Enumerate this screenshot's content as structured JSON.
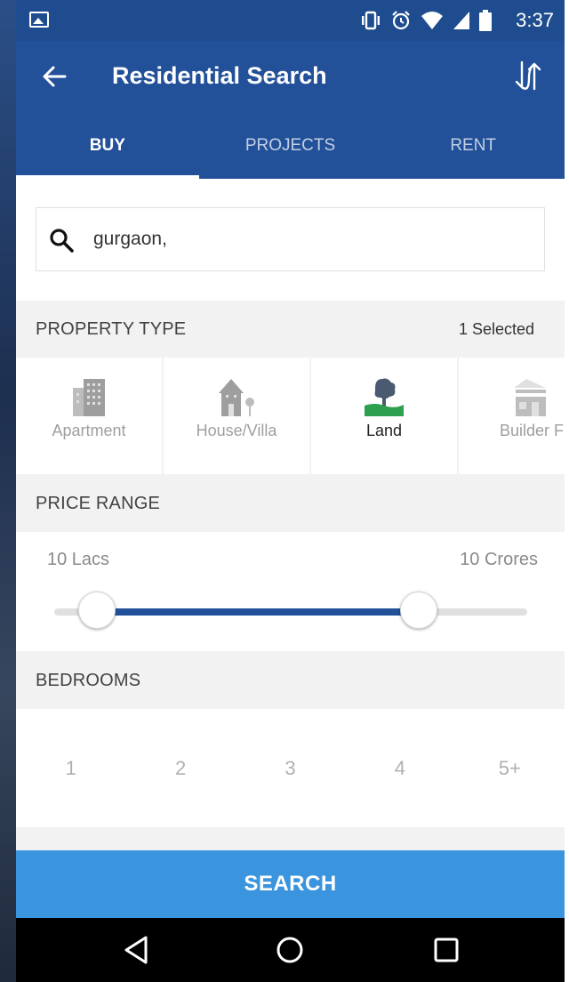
{
  "status_bar": {
    "time": "3:37",
    "icons": [
      "image-icon",
      "vibrate-icon",
      "alarm-icon",
      "wifi-icon",
      "signal-icon",
      "battery-icon"
    ]
  },
  "app_bar": {
    "title": "Residential Search",
    "back_icon": "arrow-left-icon",
    "action_icon": "sort-icon"
  },
  "tabs": [
    {
      "label": "BUY",
      "active": true
    },
    {
      "label": "PROJECTS",
      "active": false
    },
    {
      "label": "RENT",
      "active": false
    }
  ],
  "search": {
    "value": "gurgaon,",
    "icon": "search-icon"
  },
  "property_type": {
    "heading": "PROPERTY TYPE",
    "selected_count": "1 Selected",
    "items": [
      {
        "label": "Apartment",
        "icon": "apartment-icon",
        "selected": false
      },
      {
        "label": "House/Villa",
        "icon": "house-icon",
        "selected": false
      },
      {
        "label": "Land",
        "icon": "land-icon",
        "selected": true
      },
      {
        "label": "Builder F",
        "icon": "builder-floor-icon",
        "selected": false
      }
    ]
  },
  "price_range": {
    "heading": "PRICE RANGE",
    "min_label": "10 Lacs",
    "max_label": "10 Crores",
    "min_fraction": 0.09,
    "max_fraction": 0.77
  },
  "bedrooms": {
    "heading": "BEDROOMS",
    "options": [
      "1",
      "2",
      "3",
      "4",
      "5+"
    ]
  },
  "search_button": "SEARCH",
  "colors": {
    "primary": "#22519a",
    "status_bar": "#1e4c8e",
    "search_button": "#3a94de",
    "land_green": "#2e9e4f"
  }
}
